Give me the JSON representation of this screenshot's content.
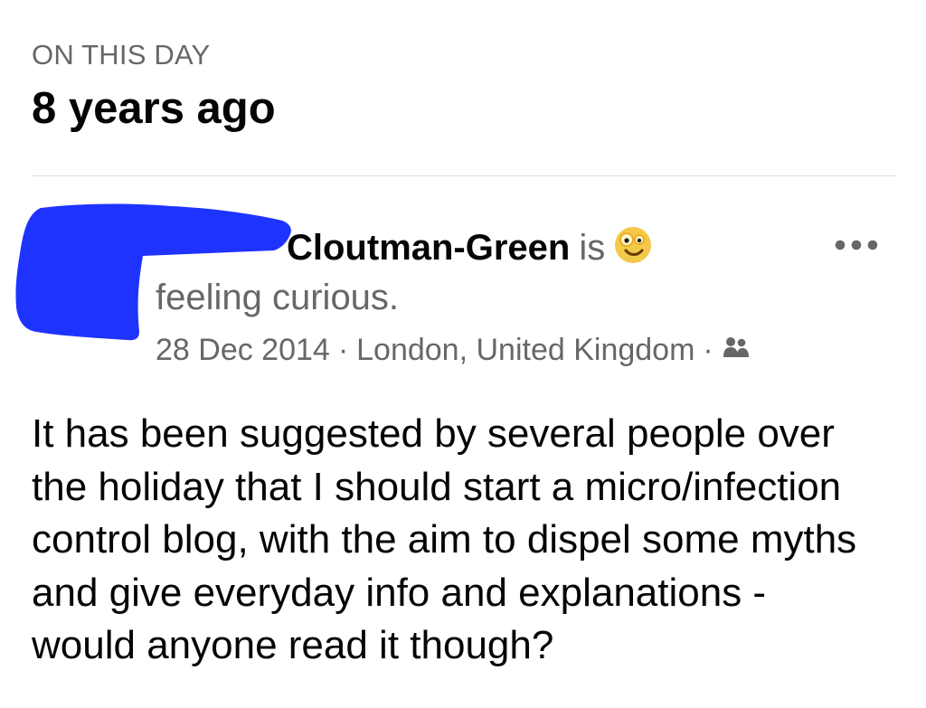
{
  "memory_header": {
    "kicker": "ON THIS DAY",
    "title": "8 years ago"
  },
  "post": {
    "author_visible_name": "Cloutman-Green",
    "status_verb": "is",
    "feeling_text": "feeling curious.",
    "feeling_icon": "curious-face-icon",
    "date": "28 Dec 2014",
    "separator": "·",
    "location": "London, United Kingdom",
    "audience_icon": "friends-icon",
    "more_icon": "more-options-icon",
    "body": "It has been suggested by several people over\nthe holiday that I should start a micro/infection\ncontrol blog, with the aim to dispel some myths\nand give everyday info and explanations -\nwould anyone read it though?",
    "redaction_color": "#1f33ff"
  },
  "colors": {
    "primary_text": "#050505",
    "secondary_text": "#65676b",
    "divider": "#dcdde1",
    "emoji_face": "#f4c94a"
  }
}
